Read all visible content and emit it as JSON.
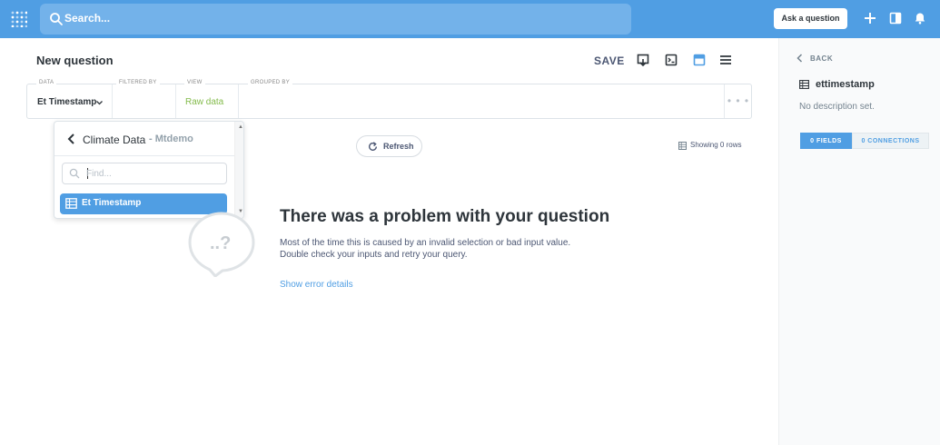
{
  "nav": {
    "search_placeholder": "Search...",
    "ask_button": "Ask a question",
    "icons": [
      "metabase-logo",
      "search-icon",
      "plus-icon",
      "collection-icon",
      "bell-icon"
    ],
    "accent": "#509ee3"
  },
  "header": {
    "title": "New question",
    "save_label": "SAVE"
  },
  "query_bar": {
    "data_label": "DATA",
    "data_value": "Et Timestamp",
    "filtered_label": "FILTERED BY",
    "view_label": "VIEW",
    "view_value": "Raw data",
    "grouped_label": "GROUPED BY",
    "more": "• • •"
  },
  "table_picker": {
    "database": "Climate Data",
    "schema": "- Mtdemo",
    "find_placeholder": "Find...",
    "items": [
      {
        "label": "Et Timestamp",
        "selected": true
      }
    ]
  },
  "results": {
    "refresh_label": "Refresh",
    "showing_label": "Showing 0 rows"
  },
  "error": {
    "bubble_text": "..?",
    "title": "There was a problem with your question",
    "description": "Most of the time this is caused by an invalid selection or bad input value. Double check your inputs and retry your query.",
    "details_link": "Show error details"
  },
  "sidebar": {
    "back_label": "BACK",
    "table_name": "ettimestamp",
    "description": "No description set.",
    "fields_tab": "0 FIELDS",
    "connections_tab": "0 CONNECTIONS"
  }
}
